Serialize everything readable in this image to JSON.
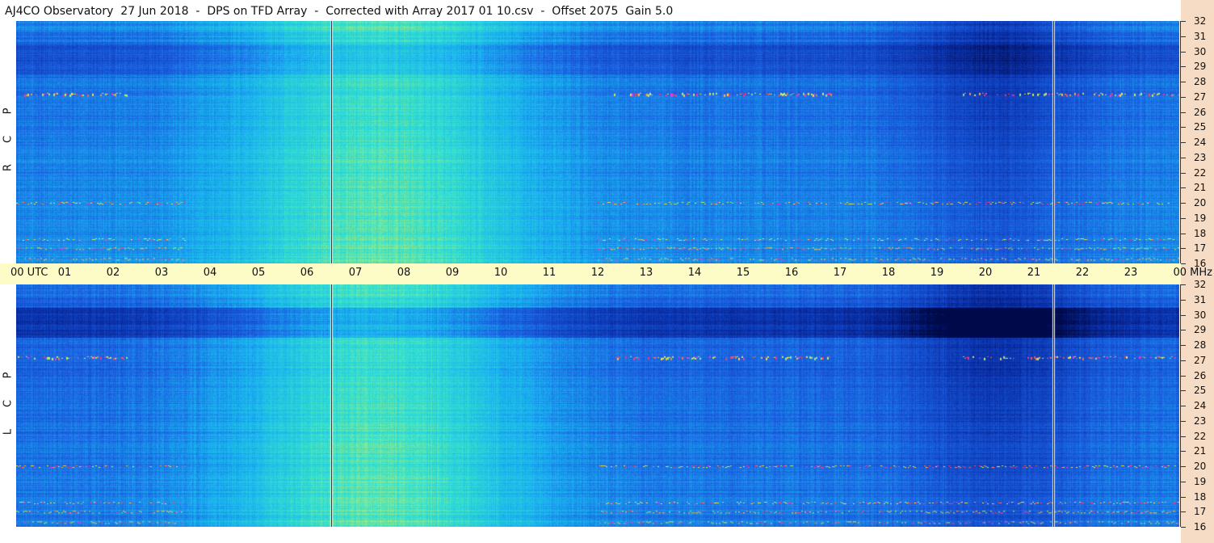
{
  "title": "AJ4CO Observatory  27 Jun 2018  -  DPS on TFD Array  -  Corrected with Array 2017 01 10.csv  -  Offset 2075  Gain 5.0",
  "chart_data": [
    {
      "type": "heatmap",
      "polarization_label": [
        "R",
        "C",
        "P"
      ],
      "x_unit": "UTC",
      "x_range": [
        0,
        24
      ],
      "x_tick_labels": [
        "00",
        "01",
        "02",
        "03",
        "04",
        "05",
        "06",
        "07",
        "08",
        "09",
        "10",
        "11",
        "12",
        "13",
        "14",
        "15",
        "16",
        "17",
        "18",
        "19",
        "20",
        "21",
        "22",
        "23",
        "00"
      ],
      "y_unit": "MHz",
      "y_range": [
        16,
        32
      ],
      "y_tick_labels": [
        "32",
        "31",
        "30",
        "29",
        "28",
        "27",
        "26",
        "25",
        "24",
        "23",
        "22",
        "21",
        "20",
        "19",
        "18",
        "17",
        "16"
      ],
      "data_gaps_utc": [
        6.5,
        21.4
      ],
      "interference_bands_mhz": [
        27.1,
        20.0,
        17.6,
        17.0,
        16.3
      ],
      "colormap": [
        "#000a4a",
        "#0a2fa8",
        "#1a5fe0",
        "#19b0f0",
        "#33e0d0",
        "#c8f060",
        "#ffe030",
        "#ff3050",
        "#ff30ff"
      ]
    },
    {
      "type": "heatmap",
      "polarization_label": [
        "L",
        "C",
        "P"
      ],
      "x_unit": "UTC",
      "x_range": [
        0,
        24
      ],
      "y_unit": "MHz",
      "y_range": [
        16,
        32
      ],
      "y_tick_labels": [
        "32",
        "31",
        "30",
        "29",
        "28",
        "27",
        "26",
        "25",
        "24",
        "23",
        "22",
        "21",
        "20",
        "19",
        "18",
        "17",
        "16"
      ],
      "data_gaps_utc": [
        6.5,
        21.4
      ],
      "interference_bands_mhz": [
        27.1,
        20.0,
        17.6,
        17.0,
        16.3
      ],
      "colormap": [
        "#000a4a",
        "#0a2fa8",
        "#1a5fe0",
        "#19b0f0",
        "#33e0d0",
        "#c8f060",
        "#ffe030",
        "#ff3050",
        "#ff30ff"
      ]
    }
  ],
  "axis": {
    "utc_label": "00  UTC",
    "mhz_label": "00 MHz"
  }
}
